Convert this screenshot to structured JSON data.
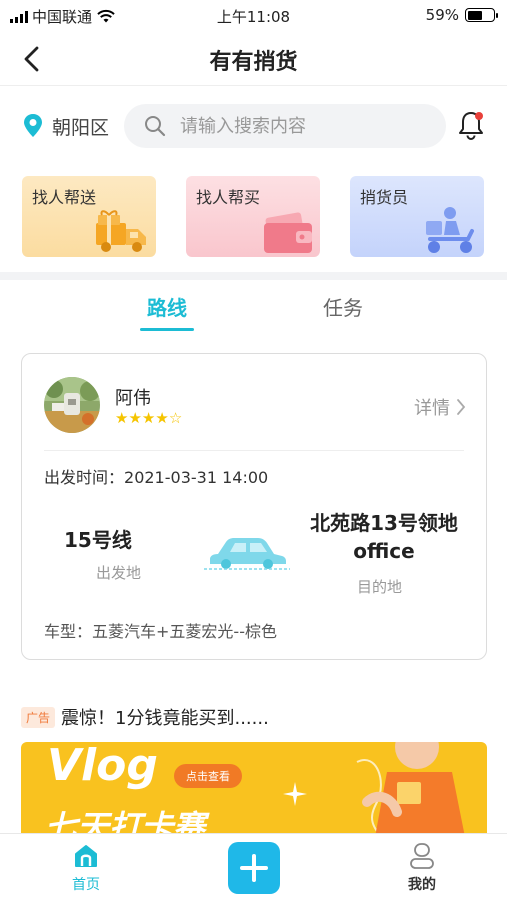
{
  "status_bar": {
    "carrier": "中国联通",
    "time": "上午11:08",
    "battery_text": "59%",
    "battery_level": 0.59
  },
  "nav": {
    "title": "有有捎货"
  },
  "search": {
    "location": "朝阳区",
    "placeholder": "请输入搜索内容"
  },
  "services": [
    {
      "label": "找人帮送",
      "icon": "delivery-truck-gift-icon"
    },
    {
      "label": "找人帮买",
      "icon": "wallet-icon"
    },
    {
      "label": "捎货员",
      "icon": "courier-scooter-icon"
    }
  ],
  "tabs": [
    {
      "label": "路线",
      "active": true
    },
    {
      "label": "任务",
      "active": false
    }
  ],
  "trip": {
    "driver_name": "阿伟",
    "rating": 4,
    "rating_max": 5,
    "detail_label": "详情",
    "depart_label": "出发时间：",
    "depart_time": "2021-03-31 14:00",
    "from_name": "15号线",
    "from_label": "出发地",
    "to_name": "北苑路13号领地office",
    "to_label": "目的地",
    "vehicle_label": "车型：",
    "vehicle_value": "五菱汽车+五菱宏光--棕色"
  },
  "ad": {
    "tag": "广告",
    "text": "震惊！1分钱竟能买到......"
  },
  "banner": {
    "title": "Vlog",
    "cta": "点击查看",
    "subtitle": "七天打卡赛"
  },
  "tab_bar": {
    "home": "首页",
    "mine": "我的"
  },
  "colors": {
    "accent": "#1cbcd4",
    "plus_button": "#1fb8e8",
    "star": "#f5c400",
    "banner": "#f9c21f"
  }
}
